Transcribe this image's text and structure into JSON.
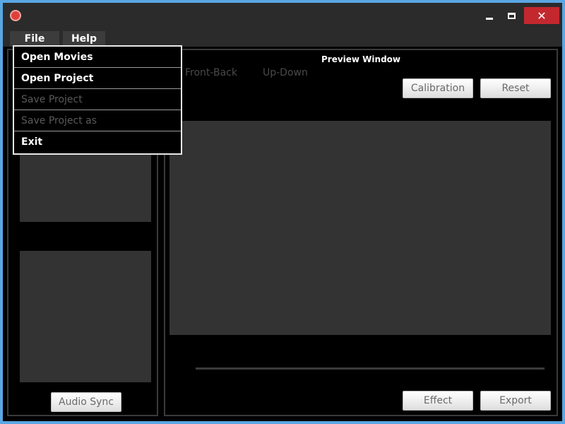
{
  "window": {
    "border_color": "#5aa7e4",
    "close_color": "#c4282f"
  },
  "menubar": {
    "file_label": "File",
    "help_label": "Help"
  },
  "file_menu": {
    "items": [
      {
        "label": "Open Movies",
        "enabled": true
      },
      {
        "label": "Open Project",
        "enabled": true
      },
      {
        "label": "Save Project",
        "enabled": false
      },
      {
        "label": "Save Project as",
        "enabled": false
      },
      {
        "label": "Exit",
        "enabled": true
      }
    ]
  },
  "left_panel": {
    "audio_sync_label": "Audio Sync"
  },
  "preview": {
    "title": "Preview Window",
    "tabs": [
      "Front-Back",
      "Up-Down"
    ],
    "calibration_label": "Calibration",
    "reset_label": "Reset",
    "effect_label": "Effect",
    "export_label": "Export"
  },
  "icons": {
    "app": "app-logo-icon",
    "minimize": "minimize-icon",
    "maximize": "maximize-icon",
    "close": "close-icon"
  }
}
